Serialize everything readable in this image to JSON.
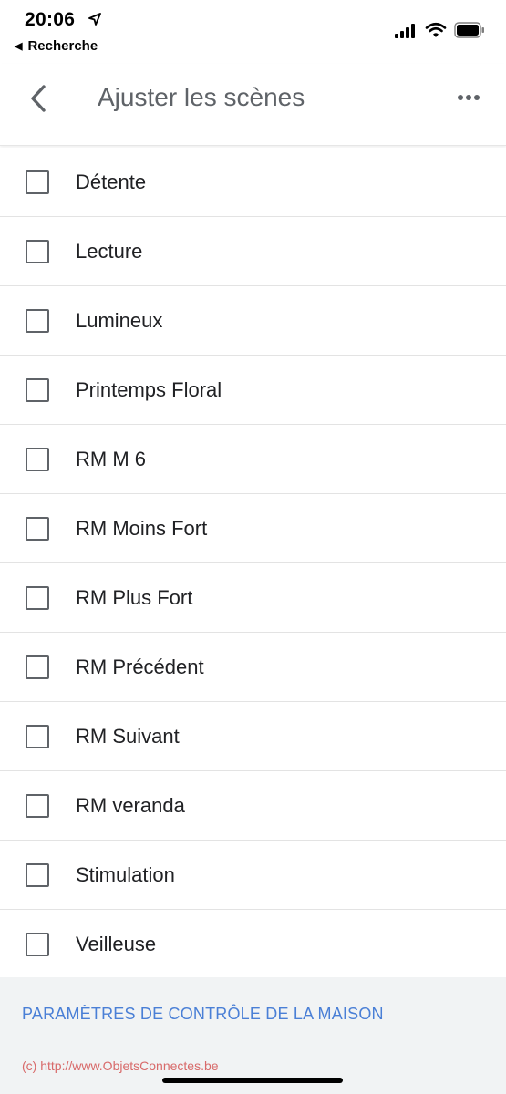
{
  "status_bar": {
    "time": "20:06",
    "back_app_label": "Recherche",
    "icons": [
      "location-arrow-icon",
      "cellular-signal-icon",
      "wifi-icon",
      "battery-icon"
    ]
  },
  "app_bar": {
    "title": "Ajuster les scènes",
    "back_icon": "chevron-left-icon",
    "more_icon": "more-horizontal-icon"
  },
  "scenes": [
    {
      "label": "Détente",
      "checked": false
    },
    {
      "label": "Lecture",
      "checked": false
    },
    {
      "label": "Lumineux",
      "checked": false
    },
    {
      "label": "Printemps Floral",
      "checked": false
    },
    {
      "label": "RM M 6",
      "checked": false
    },
    {
      "label": "RM Moins Fort",
      "checked": false
    },
    {
      "label": "RM Plus Fort",
      "checked": false
    },
    {
      "label": "RM Précédent",
      "checked": false
    },
    {
      "label": "RM Suivant",
      "checked": false
    },
    {
      "label": "RM veranda",
      "checked": false
    },
    {
      "label": "Stimulation",
      "checked": false
    },
    {
      "label": "Veilleuse",
      "checked": false
    }
  ],
  "footer": {
    "settings_link": "PARAMÈTRES DE CONTRÔLE DE LA MAISON",
    "watermark": "(c) http://www.ObjetsConnectes.be"
  },
  "colors": {
    "link": "#4a7fd6",
    "footer_background": "#f1f3f4",
    "checkbox_border": "#5f6368",
    "watermark": "#d86a6a"
  }
}
